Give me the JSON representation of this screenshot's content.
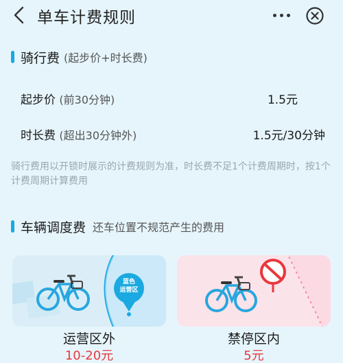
{
  "header": {
    "title": "单车计费规则",
    "back_icon": "chevron-left-icon",
    "more_icon": "more-dots-icon",
    "close_icon": "close-circle-icon"
  },
  "riding_fee": {
    "title": "骑行费",
    "subtitle": "(起步价+时长费)",
    "rows": [
      {
        "name": "起步价",
        "detail": "(前30分钟)",
        "value": "1.5元"
      },
      {
        "name": "时长费",
        "detail": "(超出30分钟外)",
        "value": "1.5元/30分钟"
      }
    ],
    "note": "骑行费用以开锁时展示的计费规则为准，时长费不足1个计费周期时，按1个计费周期计算费用"
  },
  "dispatch_fee": {
    "title": "车辆调度费",
    "subtitle": "还车位置不规范产生的费用",
    "cards": [
      {
        "title": "运营区外",
        "price": "10-20元",
        "pin_text_1": "蓝色",
        "pin_text_2": "运营区",
        "icon": "bike-outside-zone-icon"
      },
      {
        "title": "禁停区内",
        "price": "5元",
        "icon": "no-parking-sign-icon"
      }
    ]
  },
  "colors": {
    "accent": "#1aa9e0",
    "price_red": "#e8383d",
    "background": "#e6f5fc"
  }
}
